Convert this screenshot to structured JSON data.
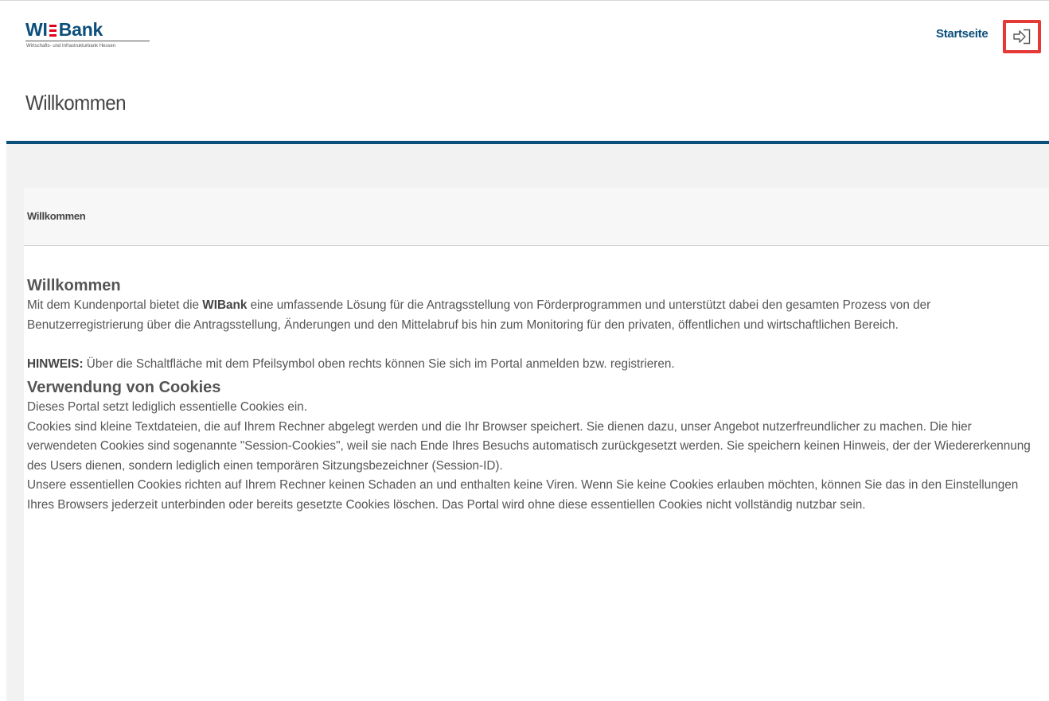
{
  "header": {
    "logo_text_left": "WI",
    "logo_text_right": "Bank",
    "logo_subtitle": "Wirtschafts- und Infrastrukturbank Hessen",
    "nav_link": "Startseite",
    "login_icon": "login-arrow-icon"
  },
  "page": {
    "title": "Willkommen"
  },
  "card": {
    "header_title": "Willkommen",
    "heading": "Willkommen",
    "intro_pre": "Mit dem Kundenportal bietet die ",
    "intro_brand": "WIBank",
    "intro_post": " eine umfassende Lösung für die Antragsstellung von Förderprogrammen und unterstützt dabei den gesamten Prozess von der Benutzerregistrierung über die Antragsstellung, Änderungen und den Mittelabruf bis hin zum Monitoring für den privaten, öffentlichen und wirtschaftlichen Bereich.",
    "hint_label": "HINWEIS:",
    "hint_text": " Über die Schaltfläche mit dem Pfeilsymbol oben rechts können Sie sich im Portal anmelden bzw. registrieren.",
    "cookies_heading": "Verwendung von Cookies",
    "cookies_p1": "Dieses Portal setzt lediglich essentielle Cookies ein.",
    "cookies_p2": "Cookies sind kleine Textdateien, die auf Ihrem Rechner abgelegt werden und die Ihr Browser speichert. Sie dienen dazu, unser Angebot nutzerfreundlicher zu machen. Die hier verwendeten Cookies sind sogenannte \"Session-Cookies\", weil sie nach Ende Ihres Besuchs automatisch zurückgesetzt werden. Sie speichern keinen Hinweis, der der Wiedererkennung des Users dienen, sondern lediglich einen temporären Sitzungsbezeichner (Session-ID).",
    "cookies_p3": "Unsere essentiellen Cookies richten auf Ihrem Rechner keinen Schaden an und enthalten keine Viren. Wenn Sie keine Cookies erlauben möchten, können Sie das in den Einstellungen Ihres Browsers jederzeit unterbinden oder bereits gesetzte Cookies löschen. Das Portal wird ohne diese essentiellen Cookies nicht vollständig nutzbar sein."
  },
  "colors": {
    "brand_blue": "#0b4f7c",
    "logo_red": "#e2001a",
    "highlight_red": "#e53935",
    "background_gray": "#f2f2f2"
  }
}
